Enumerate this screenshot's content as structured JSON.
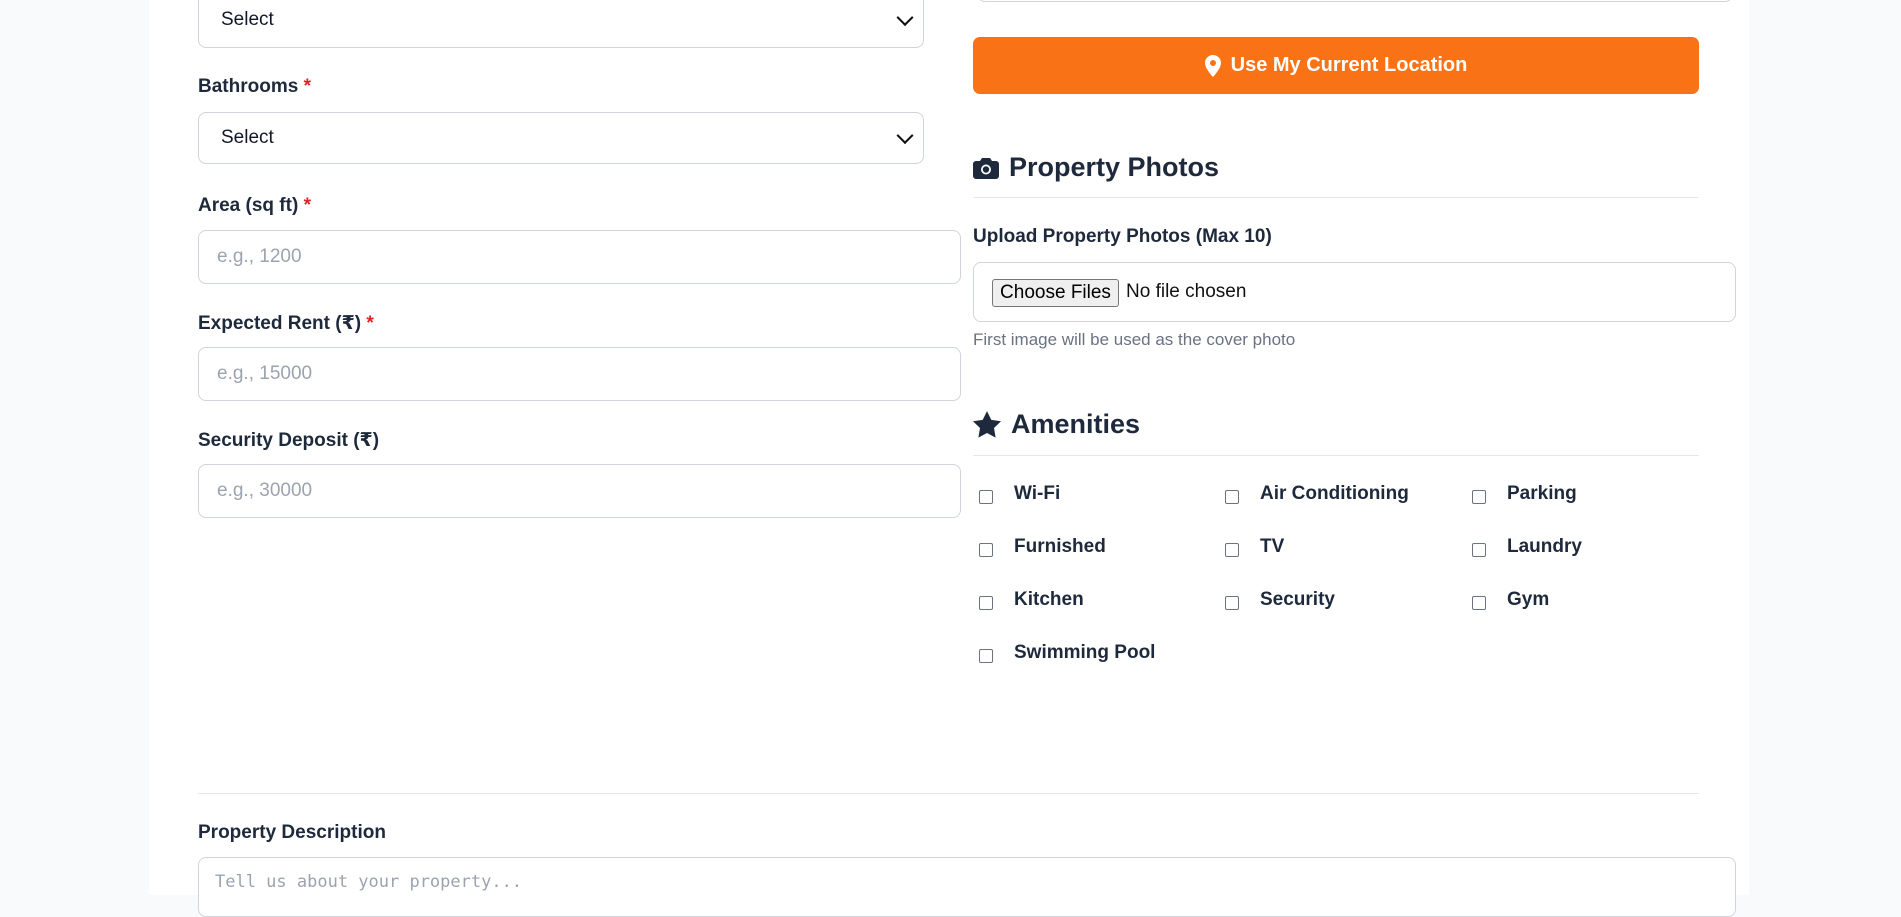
{
  "form": {
    "bedrooms_select": {
      "value": "Select"
    },
    "bathrooms": {
      "label": "Bathrooms",
      "value": "Select"
    },
    "area": {
      "label": "Area (sq ft)",
      "placeholder": "e.g., 1200"
    },
    "expected_rent": {
      "label": "Expected Rent (₹)",
      "placeholder": "e.g., 15000"
    },
    "security_deposit": {
      "label": "Security Deposit (₹)",
      "placeholder": "e.g., 30000"
    },
    "required_mark": "*"
  },
  "location": {
    "button_label": "Use My Current Location",
    "icon": "map-pin-icon"
  },
  "photos": {
    "section_title": "Property Photos",
    "icon": "camera-icon",
    "upload_label": "Upload Property Photos (Max 10)",
    "choose_button": "Choose Files",
    "file_status": "No file chosen",
    "hint": "First image will be used as the cover photo"
  },
  "amenities": {
    "section_title": "Amenities",
    "icon": "star-icon",
    "items": [
      "Wi-Fi",
      "Air Conditioning",
      "Parking",
      "Furnished",
      "TV",
      "Laundry",
      "Kitchen",
      "Security",
      "Gym",
      "Swimming Pool"
    ]
  },
  "description": {
    "label": "Property Description",
    "placeholder": "Tell us about your property..."
  },
  "colors": {
    "accent": "#f97316",
    "required": "#dc2626"
  }
}
